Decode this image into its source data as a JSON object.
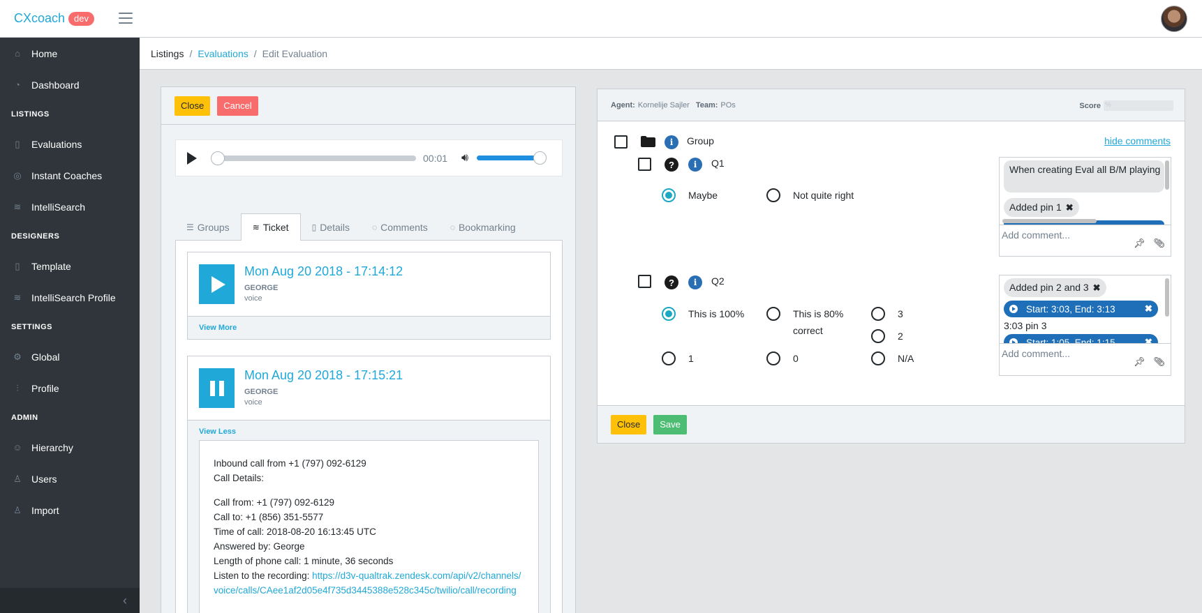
{
  "header": {
    "brand": "CXcoach",
    "badge": "dev"
  },
  "sidebar": {
    "sections": [
      {
        "type": "item",
        "label": "Home",
        "icon": "home-icon"
      },
      {
        "type": "item",
        "label": "Dashboard",
        "icon": "speedometer-icon"
      },
      {
        "type": "title",
        "label": "LISTINGS"
      },
      {
        "type": "item",
        "label": "Evaluations",
        "icon": "notebook-icon"
      },
      {
        "type": "item",
        "label": "Instant Coaches",
        "icon": "compass-icon"
      },
      {
        "type": "item",
        "label": "IntelliSearch",
        "icon": "layers-icon"
      },
      {
        "type": "title",
        "label": "DESIGNERS"
      },
      {
        "type": "item",
        "label": "Template",
        "icon": "notebook-icon"
      },
      {
        "type": "item",
        "label": "IntelliSearch Profile",
        "icon": "layers-icon"
      },
      {
        "type": "title",
        "label": "SETTINGS"
      },
      {
        "type": "item",
        "label": "Global",
        "icon": "gear-icon"
      },
      {
        "type": "item",
        "label": "Profile",
        "icon": "sliders-icon"
      },
      {
        "type": "title",
        "label": "ADMIN"
      },
      {
        "type": "item",
        "label": "Hierarchy",
        "icon": "users-icon"
      },
      {
        "type": "item",
        "label": "Users",
        "icon": "user-icon"
      },
      {
        "type": "item",
        "label": "Import",
        "icon": "user-icon"
      }
    ]
  },
  "breadcrumb": {
    "root": "Listings",
    "link": "Evaluations",
    "active": "Edit Evaluation"
  },
  "left": {
    "close_label": "Close",
    "cancel_label": "Cancel",
    "player": {
      "time": "00:01"
    },
    "tabs": [
      {
        "label": "Groups",
        "icon": "list-icon",
        "active": false
      },
      {
        "label": "Ticket",
        "icon": "layers-icon",
        "active": true
      },
      {
        "label": "Details",
        "icon": "notebook-icon",
        "active": false
      },
      {
        "label": "Comments",
        "icon": "speech-icon",
        "active": false
      },
      {
        "label": "Bookmarking",
        "icon": "speech-icon",
        "active": false
      }
    ],
    "tickets": [
      {
        "date": "Mon Aug 20 2018 - 17:14:12",
        "who": "GEORGE",
        "kind": "voice",
        "toggle": "View More"
      },
      {
        "date": "Mon Aug 20 2018 - 17:15:21",
        "who": "GEORGE",
        "kind": "voice",
        "toggle": "View Less"
      }
    ],
    "description": {
      "line1": "Inbound call from +1 (797) 092-6129",
      "line2": "Call Details:",
      "call_from": "Call from: +1 (797) 092-6129",
      "call_to": "Call to: +1 (856) 351-5577",
      "time": "Time of call: 2018-08-20 16:13:45 UTC",
      "answered": "Answered by: George",
      "length": "Length of phone call: 1 minute, 36 seconds",
      "listen": "Listen to the recording: ",
      "url": "https://d3v-qualtrak.zendesk.com/api/v2/channels/voice/calls/CAee1af2d05e4f735d3445388e528c345c/twilio/call/recording"
    }
  },
  "right": {
    "agent_label": "Agent:",
    "agent": "Kornelije Sajler",
    "team_label": "Team:",
    "team": "POs",
    "score_label": "Score",
    "score_value": "%",
    "group_label": "Group",
    "hide_comments": "hide comments",
    "q1": {
      "label": "Q1",
      "options": [
        {
          "label": "Maybe",
          "checked": true
        },
        {
          "label": "Not quite right",
          "checked": false
        }
      ],
      "comments": {
        "text": "When creating Eval all B/M playing",
        "chip": "Added pin 1",
        "placeholder": "Add comment..."
      }
    },
    "q2": {
      "label": "Q2",
      "options": [
        {
          "label": "This is 100%",
          "checked": true
        },
        {
          "label": "This is 80% correct",
          "checked": false
        },
        {
          "label": "3",
          "checked": false
        },
        {
          "label": "2",
          "checked": false
        },
        {
          "label": "1",
          "checked": false
        },
        {
          "label": "0",
          "checked": false
        },
        {
          "label": "N/A",
          "checked": false
        }
      ],
      "comments": {
        "chip": "Added pin 2 and 3",
        "pin1": "Start: 3:03, End: 3:13",
        "pin1_text": "3:03 pin 3",
        "pin2": "Start: 1:05, End: 1:15",
        "placeholder": "Add comment..."
      }
    },
    "close_label": "Close",
    "save_label": "Save"
  }
}
